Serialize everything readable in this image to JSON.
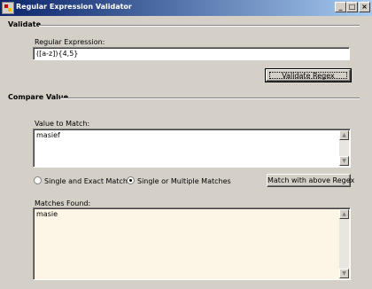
{
  "window": {
    "title": "Regular Expression Validator",
    "minimize": "_",
    "maximize": "□",
    "close": "×"
  },
  "validate": {
    "group_title": "Validate",
    "regex_label": "Regular Expression:",
    "regex_value": "([a-z]){4,5}",
    "validate_button": "Validate Regex"
  },
  "compare": {
    "group_title": "Compare Value",
    "value_label": "Value to Match:",
    "value_text": "masief",
    "radio_single_exact": "Single and  Exact Match",
    "radio_multiple": "Single or Multiple  Matches",
    "selected_option": "Single or Multiple  Matches",
    "match_button": "Match with above Regex",
    "matches_label": "Matches Found:",
    "matches_text": "masie"
  },
  "icons": {
    "scroll_up": "▲",
    "scroll_down": "▼"
  }
}
